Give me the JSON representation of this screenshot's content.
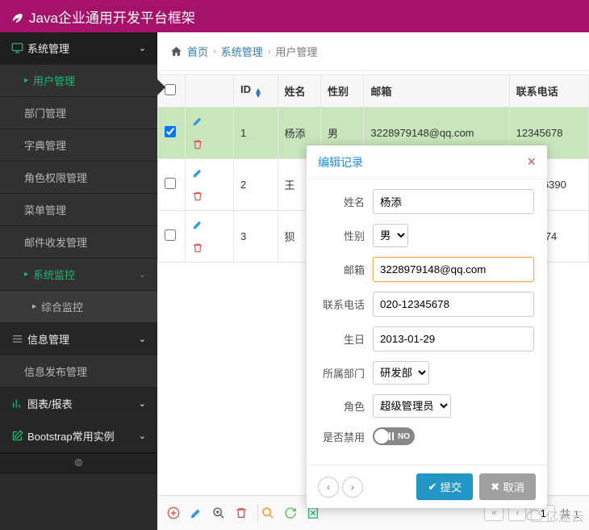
{
  "app": {
    "title": "Java企业通用开发平台框架"
  },
  "breadcrumb": {
    "home": "首页",
    "l1": "系统管理",
    "l2": "用户管理"
  },
  "sidebar": {
    "top": {
      "label": "系统管理"
    },
    "items": [
      {
        "label": "用户管理",
        "active": true
      },
      {
        "label": "部门管理"
      },
      {
        "label": "字典管理"
      },
      {
        "label": "角色权限管理"
      },
      {
        "label": "菜单管理"
      },
      {
        "label": "邮件收发管理"
      }
    ],
    "monitor": {
      "label": "系统监控",
      "child": "综合监控"
    },
    "info": {
      "label": "信息管理",
      "child": "信息发布管理"
    },
    "chart": {
      "label": "图表/报表"
    },
    "bootstrap": {
      "label": "Bootstrap常用实例"
    }
  },
  "table": {
    "headers": {
      "id": "ID",
      "name": "姓名",
      "gender": "性别",
      "email": "邮箱",
      "phone": "联系电话"
    },
    "rows": [
      {
        "id": "1",
        "name": "杨添",
        "gender": "男",
        "email": "3228979148@qq.com",
        "phone": "12345678",
        "checked": true
      },
      {
        "id": "2",
        "name": "王",
        "gender": "",
        "email": "",
        "phone": "020-26390",
        "checked": false
      },
      {
        "id": "3",
        "name": "狈",
        "gender": "",
        "email": "",
        "phone": "5836974",
        "checked": false
      }
    ]
  },
  "pager": {
    "page": "1",
    "total_prefix": "共 1"
  },
  "modal": {
    "title": "编辑记录",
    "labels": {
      "name": "姓名",
      "gender": "性别",
      "email": "邮箱",
      "phone": "联系电话",
      "birthday": "生日",
      "dept": "所属部门",
      "role": "角色",
      "disabled": "是否禁用"
    },
    "values": {
      "name": "杨添",
      "gender": "男",
      "email": "3228979148@qq.com",
      "phone": "020-12345678",
      "birthday": "2013-01-29",
      "dept": "研发部",
      "role": "超级管理员"
    },
    "toggle": "NO",
    "submit": "提交",
    "cancel": "取消"
  },
  "watermark": "亿速云"
}
